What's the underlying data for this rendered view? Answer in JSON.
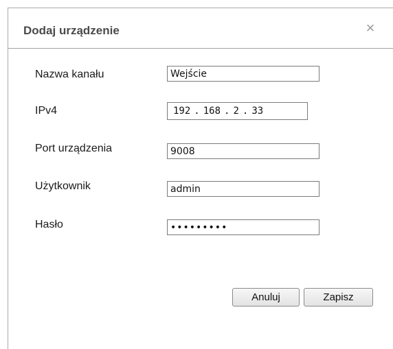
{
  "dialog": {
    "title": "Dodaj urządzenie",
    "close_icon": "close-icon",
    "close_glyph": "×"
  },
  "form": {
    "channel_name": {
      "label": "Nazwa kanału",
      "value": "Wejście"
    },
    "ipv4": {
      "label": "IPv4",
      "octets": [
        "192",
        "168",
        "2",
        "33"
      ],
      "separator": "."
    },
    "device_port": {
      "label": "Port urządzenia",
      "value": "9008"
    },
    "user": {
      "label": "Użytkownik",
      "value": "admin"
    },
    "password": {
      "label": "Hasło",
      "value": "•••••••••"
    }
  },
  "buttons": {
    "cancel_label": "Anuluj",
    "save_label": "Zapisz"
  },
  "colors": {
    "title_text": "#4a4a4a",
    "border": "#a0a0a0",
    "close_icon": "#9a9a9a"
  }
}
